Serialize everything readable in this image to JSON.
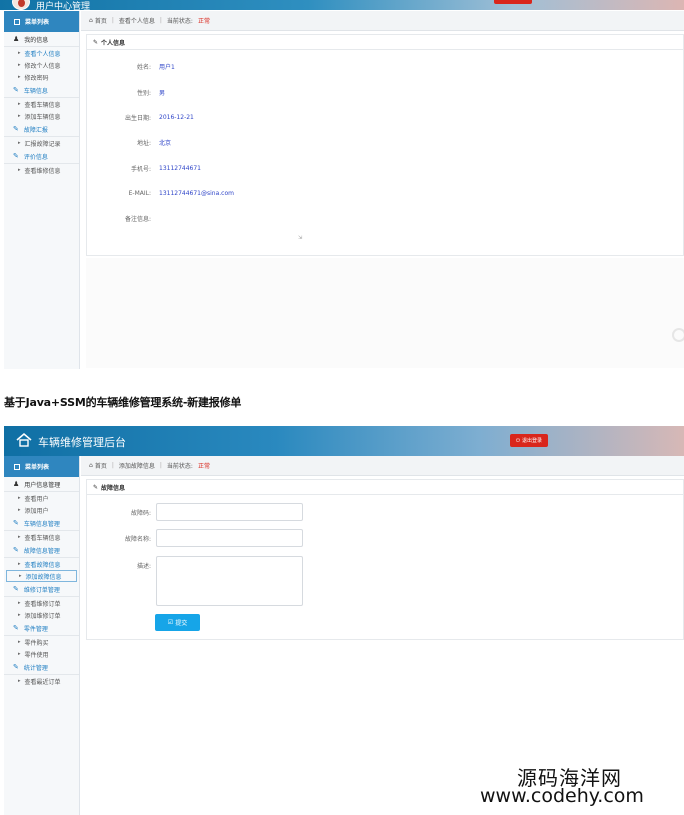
{
  "panel1": {
    "header": {
      "title": "用户中心管理"
    },
    "sidebar": {
      "menu_title": "菜单列表",
      "groups": [
        {
          "label": "我的信息",
          "items": [
            "查看个人信息",
            "修改个人信息",
            "修改密码"
          ]
        },
        {
          "label": "车辆信息",
          "items": [
            "查看车辆信息",
            "添加车辆信息"
          ]
        },
        {
          "label": "故障汇报",
          "items": [
            "汇报故障记录"
          ]
        },
        {
          "label": "评价信息",
          "items": [
            "查看维修信息"
          ]
        }
      ]
    },
    "breadcrumb": {
      "home": "首页",
      "page": "查看个人信息",
      "current_label": "当前状态:",
      "current_value": "正常"
    },
    "box": {
      "title": "个人信息",
      "fields": [
        {
          "label": "姓名:",
          "value": "用户1"
        },
        {
          "label": "性别:",
          "value": "男"
        },
        {
          "label": "出生日期:",
          "value": "2016-12-21"
        },
        {
          "label": "地址:",
          "value": "北京"
        },
        {
          "label": "手机号:",
          "value": "13112744671"
        },
        {
          "label": "E-MAIL:",
          "value": "13112744671@sina.com"
        },
        {
          "label": "备注信息:",
          "value": ""
        }
      ]
    }
  },
  "caption": "基于Java+SSM的车辆维修管理系统-新建报修单",
  "panel2": {
    "header": {
      "title": "车辆维修管理后台",
      "logout": "退出登录"
    },
    "sidebar": {
      "menu_title": "菜单列表",
      "groups": [
        {
          "label": "用户信息管理",
          "items": [
            "查看用户",
            "添加用户"
          ]
        },
        {
          "label": "车辆信息管理",
          "items": [
            "查看车辆信息"
          ]
        },
        {
          "label": "故障信息管理",
          "items": [
            "查看故障信息",
            "添加故障信息"
          ]
        },
        {
          "label": "维修订单管理",
          "items": [
            "查看维修订单",
            "添加维修订单"
          ]
        },
        {
          "label": "零件管理",
          "items": [
            "零件购买",
            "零件使用"
          ]
        },
        {
          "label": "统计管理",
          "items": [
            "查看最近订单"
          ]
        }
      ]
    },
    "breadcrumb": {
      "home": "首页",
      "page": "添加故障信息",
      "current_label": "当前状态:",
      "current_value": "正常"
    },
    "form": {
      "title": "故障信息",
      "fields": [
        {
          "label": "故障码:",
          "value": ""
        },
        {
          "label": "故障名称:",
          "value": ""
        },
        {
          "label": "描述:",
          "value": ""
        }
      ],
      "submit": "提交"
    }
  },
  "watermark": {
    "cn": "源码海洋网",
    "url": "www.codehy.com"
  }
}
